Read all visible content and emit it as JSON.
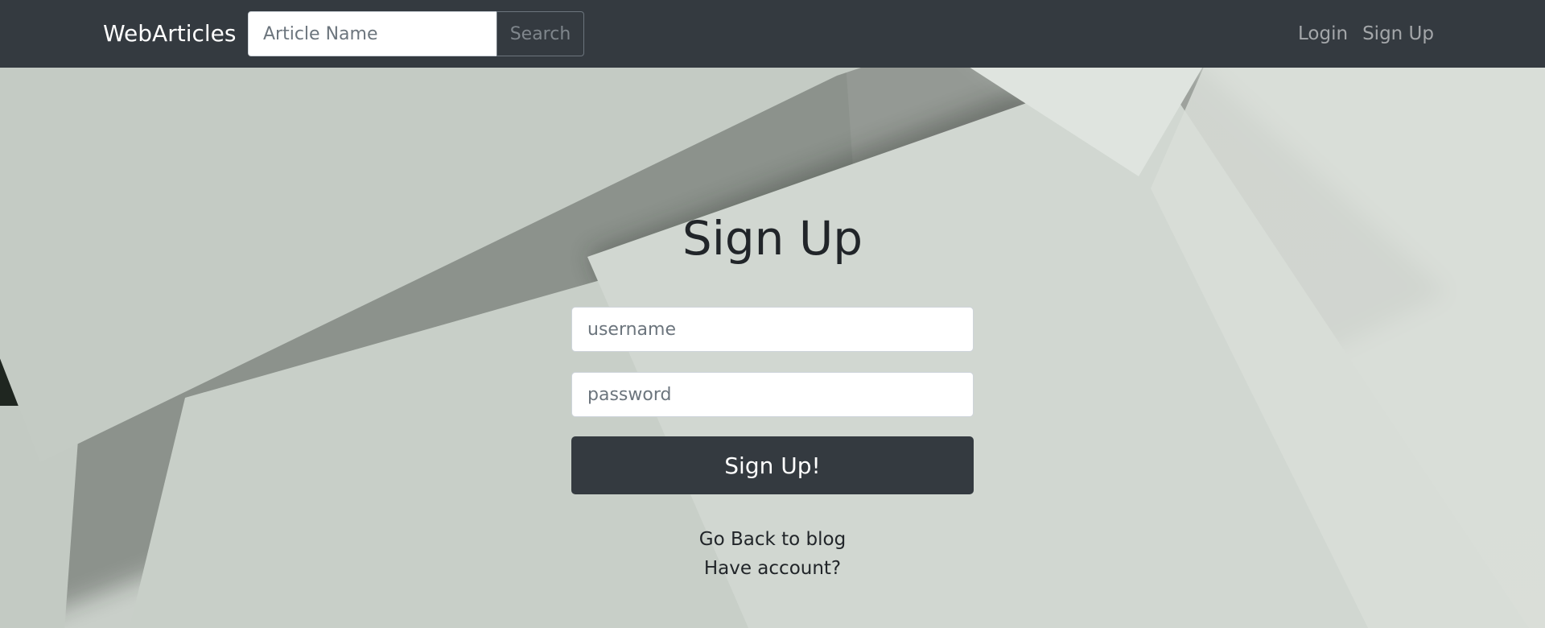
{
  "navbar": {
    "brand": "WebArticles",
    "search_placeholder": "Article Name",
    "search_button": "Search",
    "links": {
      "login": "Login",
      "signup": "Sign Up"
    }
  },
  "form": {
    "title": "Sign Up",
    "username_placeholder": "username",
    "password_placeholder": "password",
    "submit_label": "Sign Up!",
    "back_link": "Go Back to blog",
    "account_link": "Have account?"
  },
  "colors": {
    "navbar": "#343a40",
    "button": "#343a40",
    "background": "#ccd3cd"
  }
}
